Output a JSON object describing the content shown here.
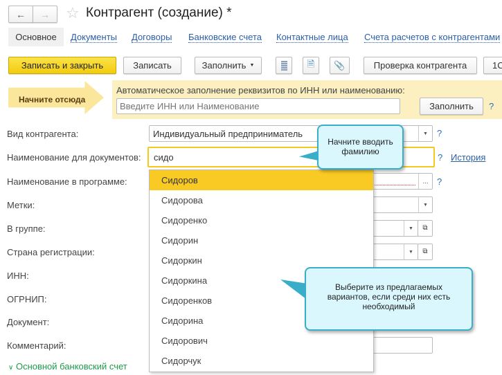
{
  "header": {
    "title": "Контрагент (создание) *",
    "back_icon": "arrow-left",
    "forward_icon": "arrow-right",
    "favorite_icon": "star"
  },
  "tabs": [
    {
      "label": "Основное"
    },
    {
      "label": "Документы"
    },
    {
      "label": "Договоры"
    },
    {
      "label": "Банковские счета"
    },
    {
      "label": "Контактные лица"
    },
    {
      "label": "Счета расчетов с контрагентами"
    }
  ],
  "toolbar": {
    "save_close": "Записать и закрыть",
    "save": "Записать",
    "fill": "Заполнить",
    "check": "Проверка контрагента",
    "one_c": "1С",
    "accent": "#f7d117"
  },
  "autofill": {
    "start_here": "Начните отсюда",
    "caption": "Автоматическое заполнение реквизитов по ИНН или наименованию:",
    "placeholder": "Введите ИНН или Наименование",
    "fill_button": "Заполнить",
    "help": "?"
  },
  "form": {
    "labels": [
      "Вид контрагента:",
      "Наименование для документов:",
      "Наименование в программе:",
      "Метки:",
      "В группе:",
      "Страна регистрации:",
      "ИНН:",
      "ОГРНИП:",
      "Документ:",
      "Комментарий:"
    ],
    "kind_value": "Индивидуальный предприниматель",
    "name_value": "сидо",
    "history_link": "История",
    "bank_section": "Основной банковский счет",
    "ellipsis": "..."
  },
  "suggestions": {
    "selected_index": 0,
    "items": [
      "Сидоров",
      "Сидорова",
      "Сидоренко",
      "Сидорин",
      "Сидоркин",
      "Сидоркина",
      "Сидоренков",
      "Сидорина",
      "Сидорович",
      "Сидорчук"
    ]
  },
  "tooltips": {
    "start_typing": "Начните вводить фамилию",
    "choose": "Выберите из предлагаемых вариантов, если среди них есть необходимый"
  }
}
